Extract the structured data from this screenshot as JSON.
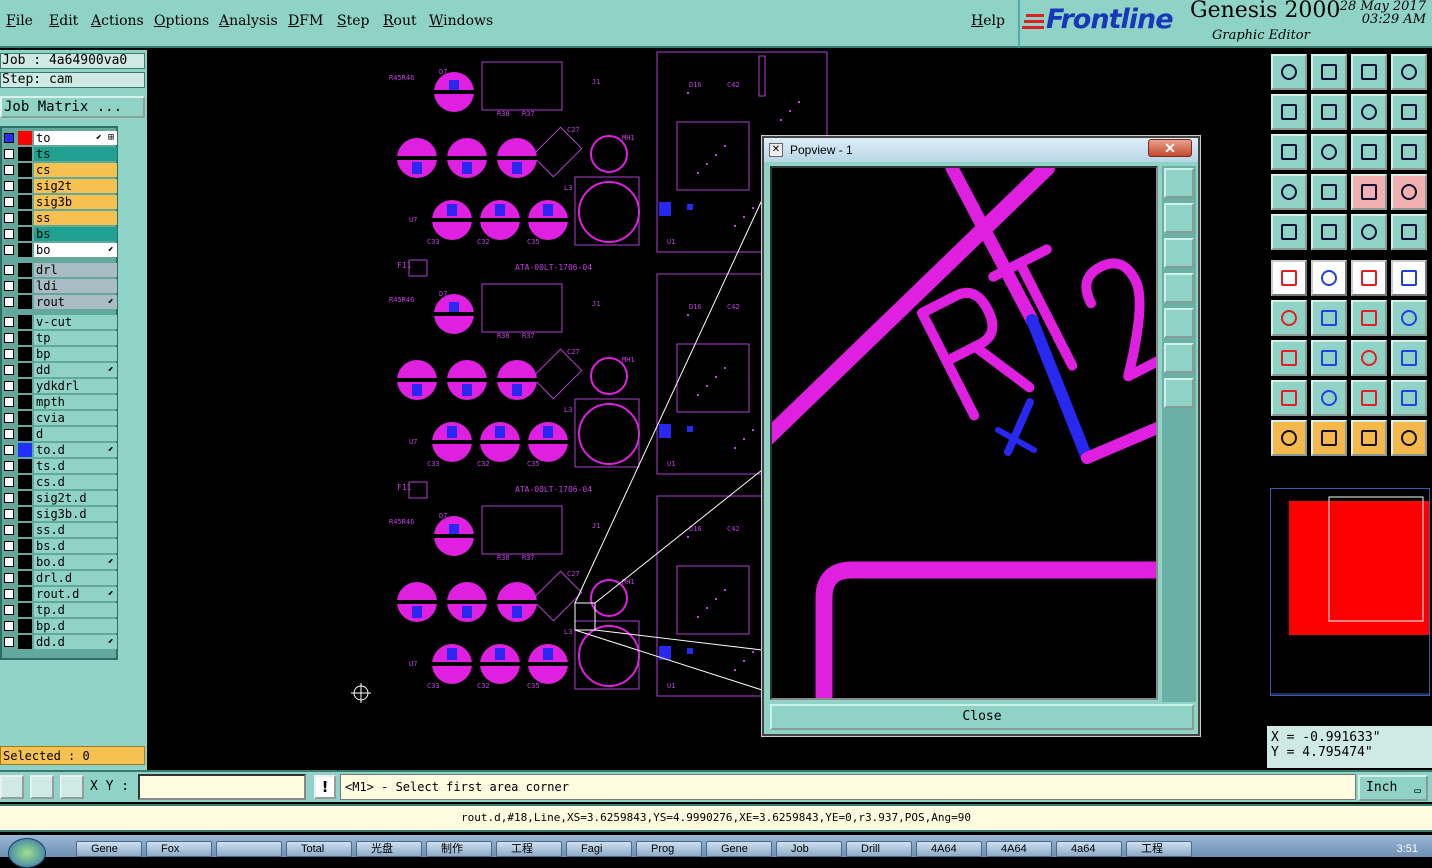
{
  "menu": {
    "items": [
      "File",
      "Edit",
      "Actions",
      "Options",
      "Analysis",
      "DFM",
      "Step",
      "Rout",
      "Windows"
    ],
    "help": "Help"
  },
  "brand": {
    "name": "Frontline",
    "product": "Genesis 2000",
    "subtitle": "Graphic Editor",
    "date": "28 May 2017",
    "time": "03:29 AM"
  },
  "job": {
    "job_line": "Job : 4a64900va0",
    "step_line": "Step: cam",
    "matrix_button": "Job Matrix ..."
  },
  "layers": [
    {
      "name": "to",
      "color": "#ff0000",
      "bg": "#ffffff",
      "mark": "⬋ ⊞",
      "checked": true
    },
    {
      "name": "ts",
      "color": "#000000",
      "bg": "#1fa090",
      "mark": ""
    },
    {
      "name": "cs",
      "color": "#000000",
      "bg": "#f5c150",
      "mark": ""
    },
    {
      "name": "sig2t",
      "color": "#000000",
      "bg": "#f5c150",
      "mark": ""
    },
    {
      "name": "sig3b",
      "color": "#000000",
      "bg": "#f5c150",
      "mark": ""
    },
    {
      "name": "ss",
      "color": "#000000",
      "bg": "#f5c150",
      "mark": ""
    },
    {
      "name": "bs",
      "color": "#000000",
      "bg": "#1fa090",
      "mark": ""
    },
    {
      "name": "bo",
      "color": "#000000",
      "bg": "#ffffff",
      "mark": "⬋"
    },
    {
      "name": "drl",
      "color": "#000000",
      "bg": "#a9bcc4",
      "mark": ""
    },
    {
      "name": "ldi",
      "color": "#000000",
      "bg": "#a9bcc4",
      "mark": ""
    },
    {
      "name": "rout",
      "color": "#000000",
      "bg": "#a9bcc4",
      "mark": "⬋"
    },
    {
      "name": "v-cut",
      "color": "#000000",
      "bg": "#8fd3c7",
      "mark": ""
    },
    {
      "name": "tp",
      "color": "#000000",
      "bg": "#8fd3c7",
      "mark": ""
    },
    {
      "name": "bp",
      "color": "#000000",
      "bg": "#8fd3c7",
      "mark": ""
    },
    {
      "name": "dd",
      "color": "#000000",
      "bg": "#8fd3c7",
      "mark": "⬋"
    },
    {
      "name": "ydkdrl",
      "color": "#000000",
      "bg": "#8fd3c7",
      "mark": ""
    },
    {
      "name": "mpth",
      "color": "#000000",
      "bg": "#8fd3c7",
      "mark": ""
    },
    {
      "name": "cvia",
      "color": "#000000",
      "bg": "#8fd3c7",
      "mark": ""
    },
    {
      "name": "d",
      "color": "#000000",
      "bg": "#8fd3c7",
      "mark": ""
    },
    {
      "name": "to.d",
      "color": "#2030ff",
      "bg": "#8fd3c7",
      "mark": "⬋"
    },
    {
      "name": "ts.d",
      "color": "#000000",
      "bg": "#8fd3c7",
      "mark": ""
    },
    {
      "name": "cs.d",
      "color": "#000000",
      "bg": "#8fd3c7",
      "mark": ""
    },
    {
      "name": "sig2t.d",
      "color": "#000000",
      "bg": "#8fd3c7",
      "mark": ""
    },
    {
      "name": "sig3b.d",
      "color": "#000000",
      "bg": "#8fd3c7",
      "mark": ""
    },
    {
      "name": "ss.d",
      "color": "#000000",
      "bg": "#8fd3c7",
      "mark": ""
    },
    {
      "name": "bs.d",
      "color": "#000000",
      "bg": "#8fd3c7",
      "mark": ""
    },
    {
      "name": "bo.d",
      "color": "#000000",
      "bg": "#8fd3c7",
      "mark": "⬋"
    },
    {
      "name": "drl.d",
      "color": "#000000",
      "bg": "#8fd3c7",
      "mark": ""
    },
    {
      "name": "rout.d",
      "color": "#000000",
      "bg": "#8fd3c7",
      "mark": "⬋"
    },
    {
      "name": "tp.d",
      "color": "#000000",
      "bg": "#8fd3c7",
      "mark": ""
    },
    {
      "name": "bp.d",
      "color": "#000000",
      "bg": "#8fd3c7",
      "mark": ""
    },
    {
      "name": "dd.d",
      "color": "#000000",
      "bg": "#8fd3c7",
      "mark": "⬋"
    }
  ],
  "selected": "Selected : 0",
  "popview": {
    "title": "Popview - 1",
    "close_x": "✕",
    "close_button": "Close",
    "silk_text": "RT2"
  },
  "board_text": {
    "label_a": "ATA-00LT-1706-04",
    "refs": [
      "D7",
      "J1",
      "D16",
      "R52",
      "C42",
      "MH1",
      "C11",
      "U1",
      "Y1",
      "C27",
      "L3",
      "U7",
      "C33",
      "C32",
      "C35",
      "F11",
      "R45R46",
      "R39",
      "C92",
      "R38",
      "R37",
      "C45",
      "C28",
      "C1",
      "Y2",
      "C2",
      "C40",
      "25"
    ]
  },
  "coords": {
    "x": "X = -0.991633\"",
    "y": "Y =  4.795474\""
  },
  "command": {
    "xy_label": "X Y :",
    "xy_value": "",
    "bang": "!",
    "prompt": "<M1> - Select first area corner",
    "units": "Inch"
  },
  "status": "rout.d,#18,Line,XS=3.6259843,YS=4.9990276,XE=3.6259843,YE=0,r3.937,POS,Ang=90",
  "taskbar": {
    "items": [
      "Gene",
      "Fox",
      "",
      "Total",
      "光盘",
      "制作",
      "工程",
      "Fagi",
      "Prog",
      "Gene",
      "Job",
      "Drill",
      "4A64",
      "4A64",
      "4a64",
      "工程"
    ],
    "clock": "3:51"
  },
  "colors": {
    "panel": "#8fd3c7",
    "magenta": "#e020e0",
    "blue": "#2828f0",
    "accent": "#1838b8"
  }
}
